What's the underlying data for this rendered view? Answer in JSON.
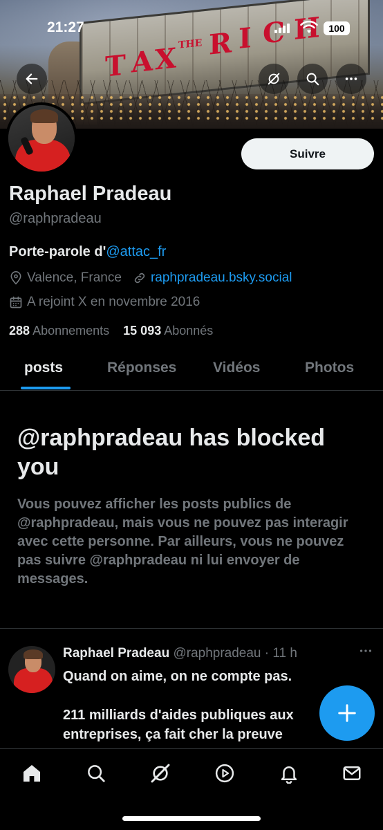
{
  "status_bar": {
    "time": "21:27",
    "battery": "100"
  },
  "banner": {
    "letters": [
      "T",
      "A",
      "X",
      "THE",
      "R",
      "I",
      "C",
      "H"
    ]
  },
  "profile": {
    "follow_label": "Suivre",
    "name": "Raphael Pradeau",
    "handle": "@raphpradeau",
    "bio_prefix": "Porte-parole d'",
    "bio_mention": "@attac_fr",
    "location": "Valence, France",
    "website": "raphpradeau.bsky.social",
    "joined": "A rejoint X en novembre 2016",
    "following_count": "288",
    "following_label": "Abonnements",
    "followers_count": "15 093",
    "followers_label": "Abonnés"
  },
  "tabs": [
    {
      "label": "posts"
    },
    {
      "label": "Réponses"
    },
    {
      "label": "Vidéos"
    },
    {
      "label": "Photos"
    }
  ],
  "blocked": {
    "title": "@raphpradeau has blocked you",
    "body": "Vous pouvez afficher les posts publics de @raphpradeau, mais vous ne pouvez pas interagir avec cette personne. Par ailleurs, vous ne pouvez pas suivre @raphpradeau ni lui envoyer de messages."
  },
  "post": {
    "author": "Raphael Pradeau",
    "handle_time": "@raphpradeau · 11 h",
    "text": "Quand on aime, on ne compte pas.\n\n211 milliards d'aides publiques aux entreprises, ça fait cher la preuve"
  },
  "colors": {
    "accent": "#1d9bf0",
    "text": "#e7e9ea",
    "muted": "#71767b",
    "background": "#000000"
  },
  "icons": {
    "back": "arrow-left-icon",
    "grok": "grok-icon",
    "search": "search-icon",
    "more": "more-icon",
    "location": "location-icon",
    "link": "link-icon",
    "calendar": "calendar-icon",
    "compose": "plus-icon",
    "nav": [
      "home-icon",
      "search-icon",
      "grok-icon",
      "video-icon",
      "bell-icon",
      "mail-icon"
    ]
  }
}
